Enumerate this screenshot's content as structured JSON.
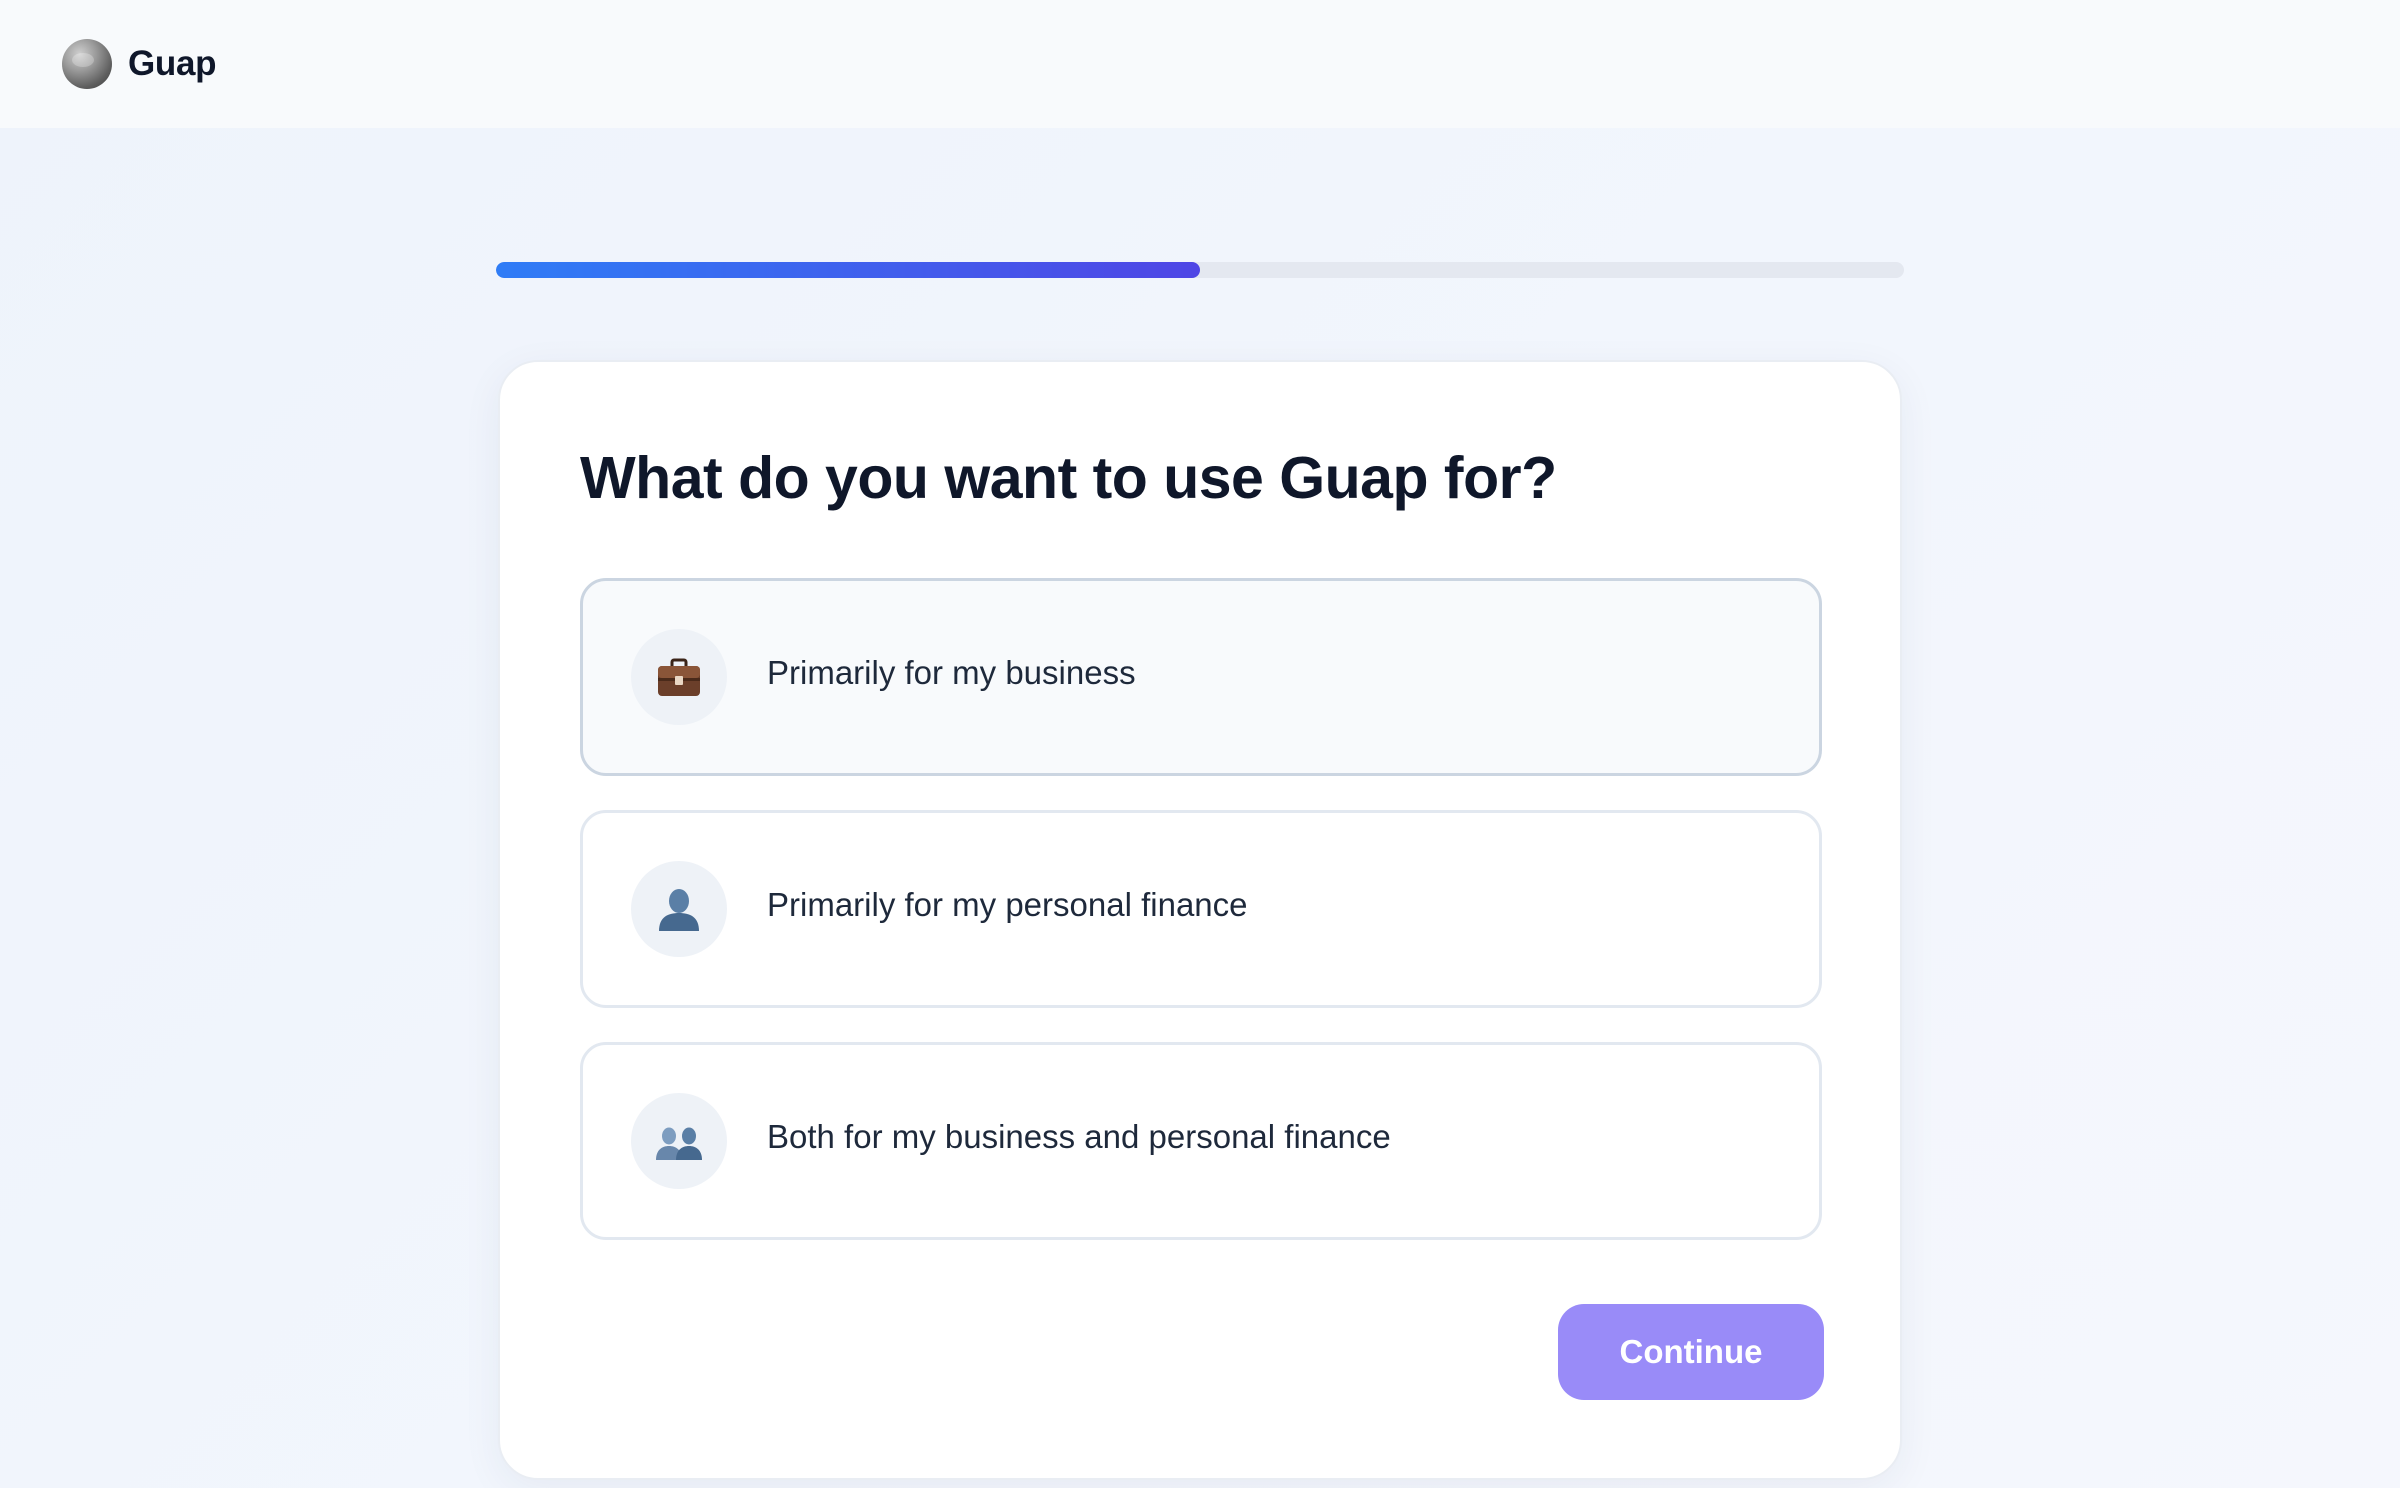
{
  "header": {
    "brand_name": "Guap",
    "logo_icon": "globe-logo-icon"
  },
  "progress": {
    "value": 0.5,
    "colors": {
      "start": "#2f7cf6",
      "end": "#4f46e5",
      "track": "#e4e8f0"
    }
  },
  "card": {
    "question": "What do you want to use Guap for?",
    "options": [
      {
        "label": "Primarily for my business",
        "icon": "briefcase-icon",
        "state": "hovered"
      },
      {
        "label": "Primarily for my personal finance",
        "icon": "person-icon",
        "state": "default"
      },
      {
        "label": "Both for my business and personal finance",
        "icon": "two-people-icon",
        "state": "default"
      }
    ],
    "continue_label": "Continue",
    "continue_color": "#998bf8"
  }
}
